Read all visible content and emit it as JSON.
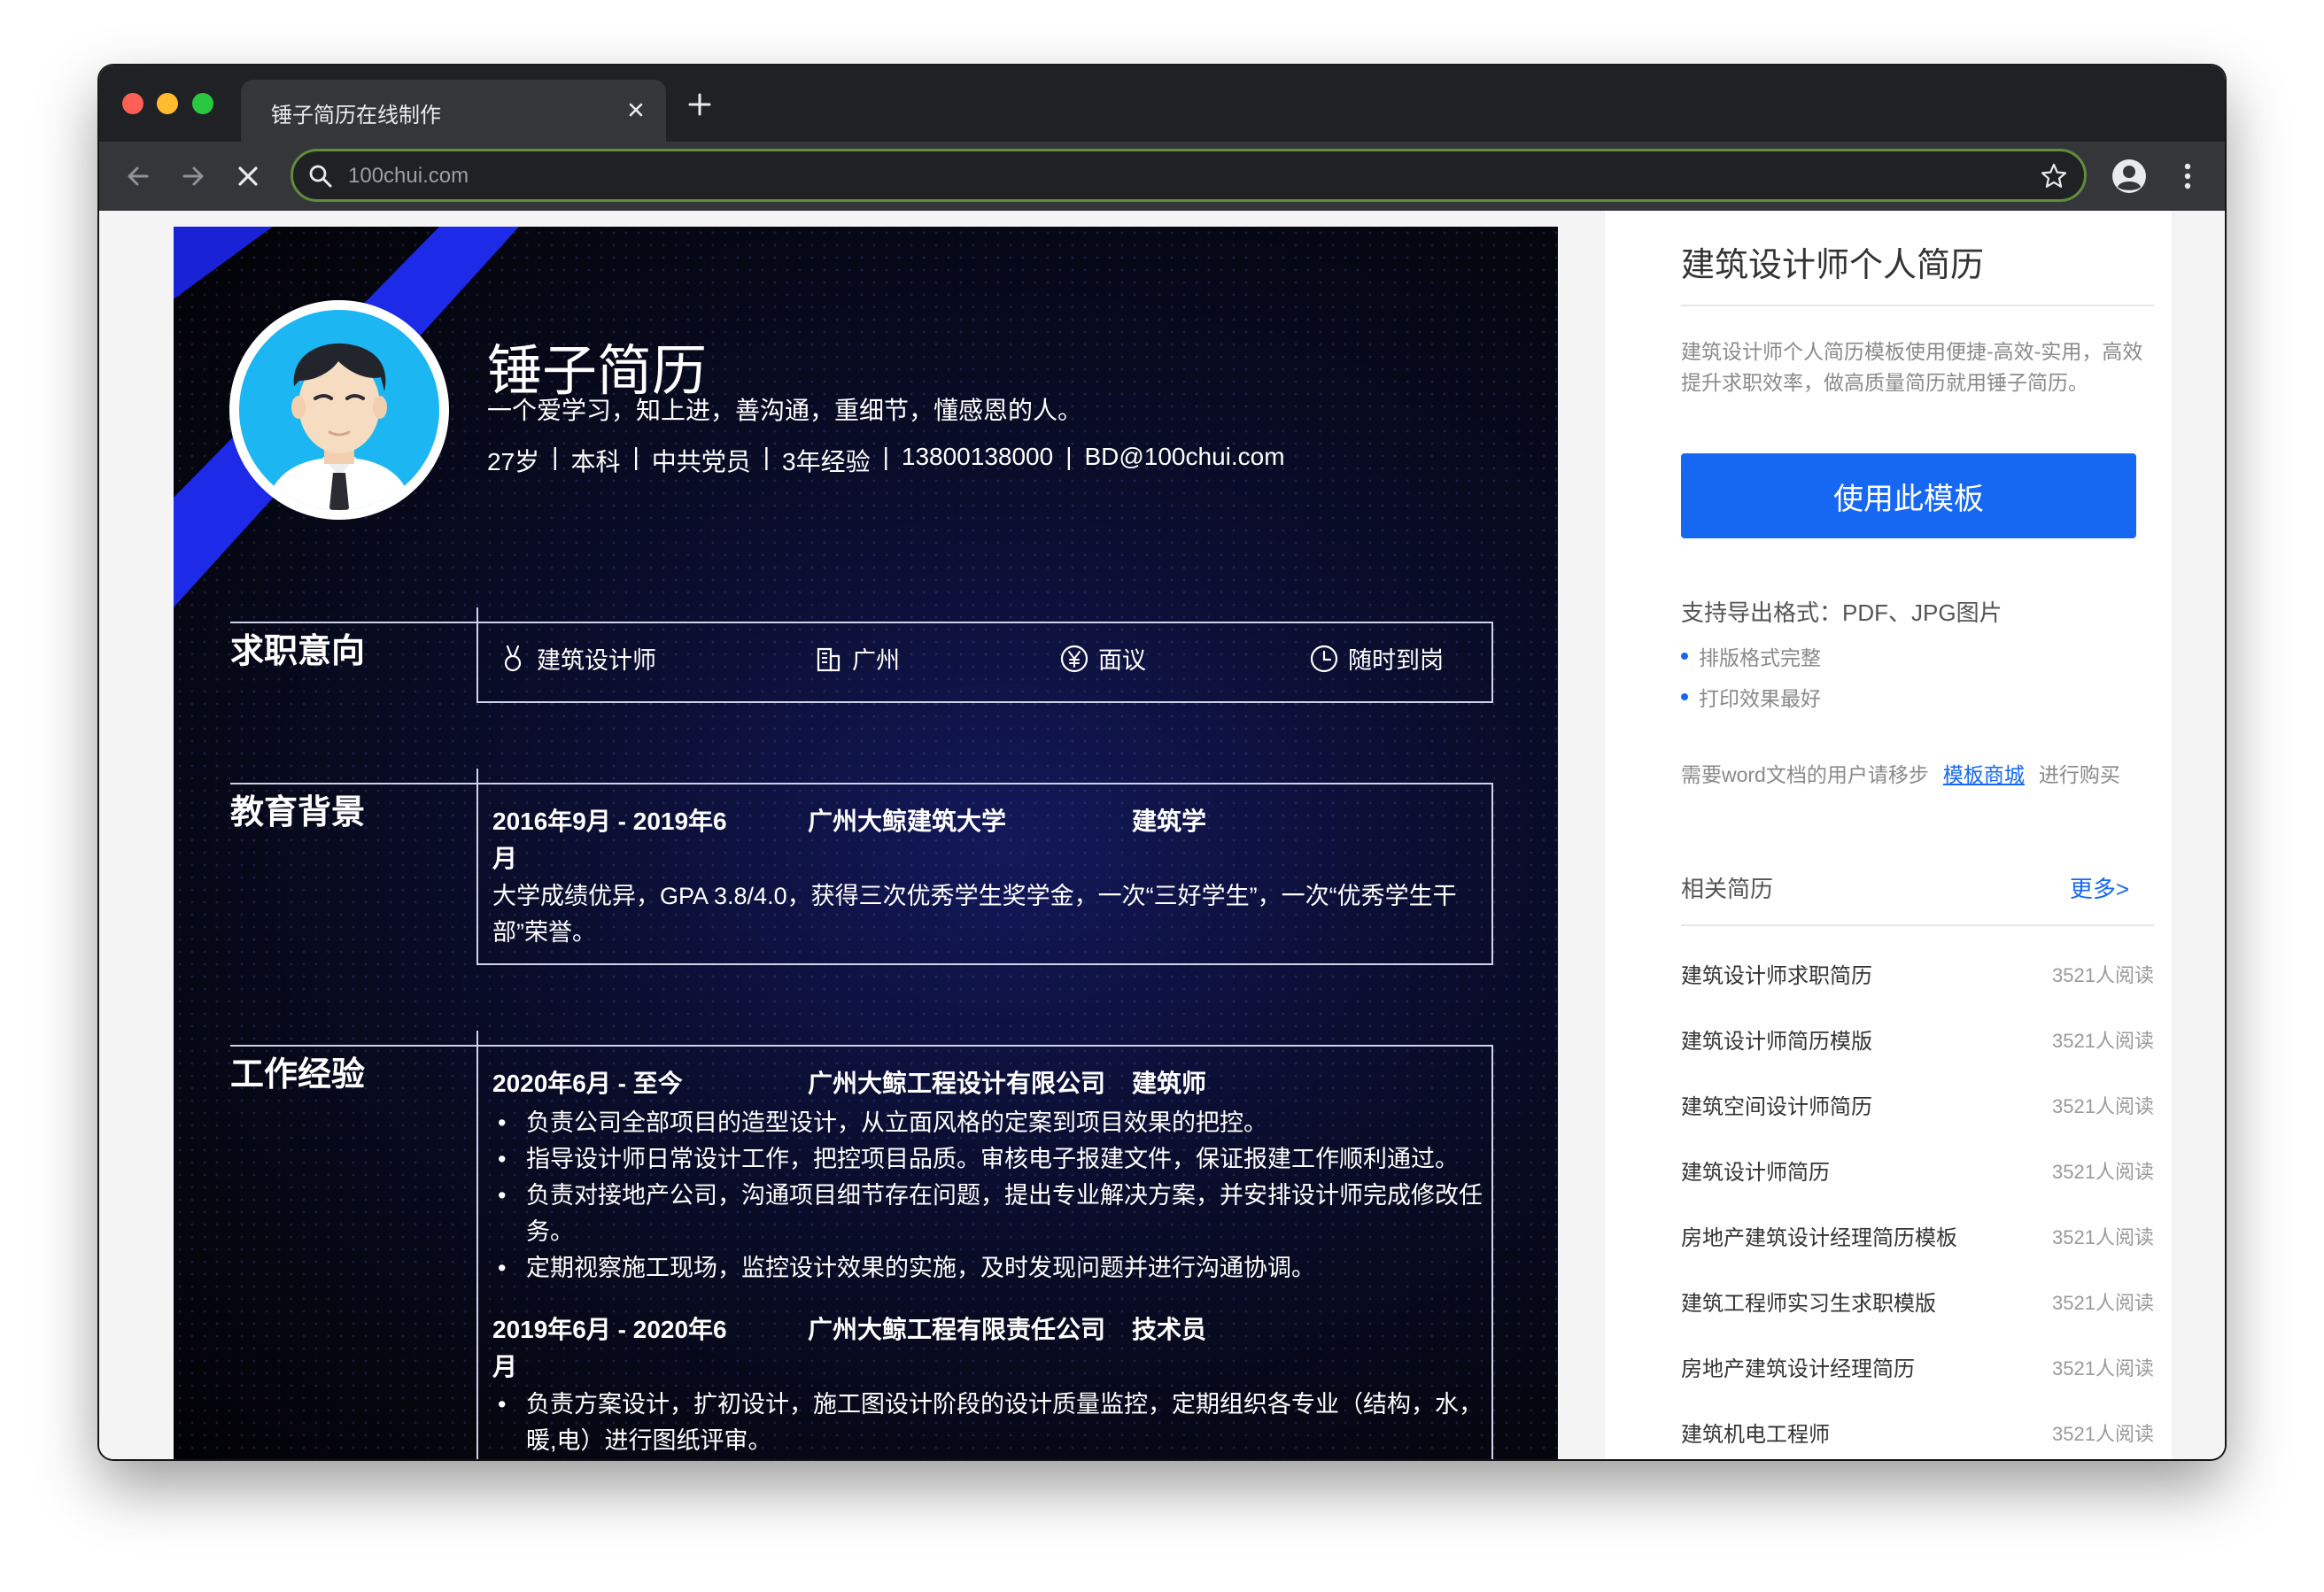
{
  "browser": {
    "tab_title": "锤子简历在线制作",
    "url": "100chui.com"
  },
  "resume": {
    "name": "锤子简历",
    "motto": "一个爱学习，知上进，善沟通，重细节，懂感恩的人。",
    "info": [
      "27岁",
      "本科",
      "中共党员",
      "3年经验",
      "13800138000",
      "BD@100chui.com"
    ],
    "info_separator": "|",
    "sections": {
      "intent": "求职意向",
      "education": "教育背景",
      "work": "工作经验"
    },
    "intent": {
      "position": "建筑设计师",
      "city": "广州",
      "salary": "面议",
      "availability": "随时到岗"
    },
    "education": {
      "period_line1": "2016年9月 - 2019年6",
      "period_line2": "月",
      "school": "广州大鲸建筑大学",
      "major": "建筑学",
      "desc": "大学成绩优异，GPA 3.8/4.0，获得三次优秀学生奖学金，一次“三好学生”，一次“优秀学生干部”荣誉。"
    },
    "work": [
      {
        "period_line1": "2020年6月 - 至今",
        "period_line2": "",
        "company": "广州大鲸工程设计有限公司",
        "role": "建筑师",
        "bullets": [
          "负责公司全部项目的造型设计，从立面风格的定案到项目效果的把控。",
          "指导设计师日常设计工作，把控项目品质。审核电子报建文件，保证报建工作顺利通过。",
          "负责对接地产公司，沟通项目细节存在问题，提出专业解决方案，并安排设计师完成修改任务。",
          "定期视察施工现场，监控设计效果的实施，及时发现问题并进行沟通协调。"
        ]
      },
      {
        "period_line1": "2019年6月 - 2020年6",
        "period_line2": "月",
        "company": "广州大鲸工程有限责任公司",
        "role": "技术员",
        "bullets": [
          "负责方案设计，扩初设计，施工图设计阶段的设计质量监控，定期组织各专业（结构，水，暖,电）进行图纸评审。"
        ]
      }
    ]
  },
  "sidebar": {
    "title": "建筑设计师个人简历",
    "desc": "建筑设计师个人简历模板使用便捷-高效-实用，高效提升求职效率，做高质量简历就用锤子简历。",
    "use_button": "使用此模板",
    "export_formats": "支持导出格式：PDF、JPG图片",
    "features": [
      "排版格式完整",
      "打印效果最好"
    ],
    "word_prefix": "需要word文档的用户请移步",
    "word_link": "模板商城",
    "word_suffix": "进行购买",
    "related_title": "相关简历",
    "more": "更多>",
    "related": [
      {
        "name": "建筑设计师求职简历",
        "reads": "3521人阅读"
      },
      {
        "name": "建筑设计师简历模版",
        "reads": "3521人阅读"
      },
      {
        "name": "建筑空间设计师简历",
        "reads": "3521人阅读"
      },
      {
        "name": "建筑设计师简历",
        "reads": "3521人阅读"
      },
      {
        "name": "房地产建筑设计经理简历模板",
        "reads": "3521人阅读"
      },
      {
        "name": "建筑工程师实习生求职模版",
        "reads": "3521人阅读"
      },
      {
        "name": "房地产建筑设计经理简历",
        "reads": "3521人阅读"
      },
      {
        "name": "建筑机电工程师",
        "reads": "3521人阅读"
      }
    ]
  },
  "colors": {
    "accent_blue": "#1668f2",
    "stripe_blue": "#1d2be8",
    "avatar_ring": "#1cb6f2"
  }
}
